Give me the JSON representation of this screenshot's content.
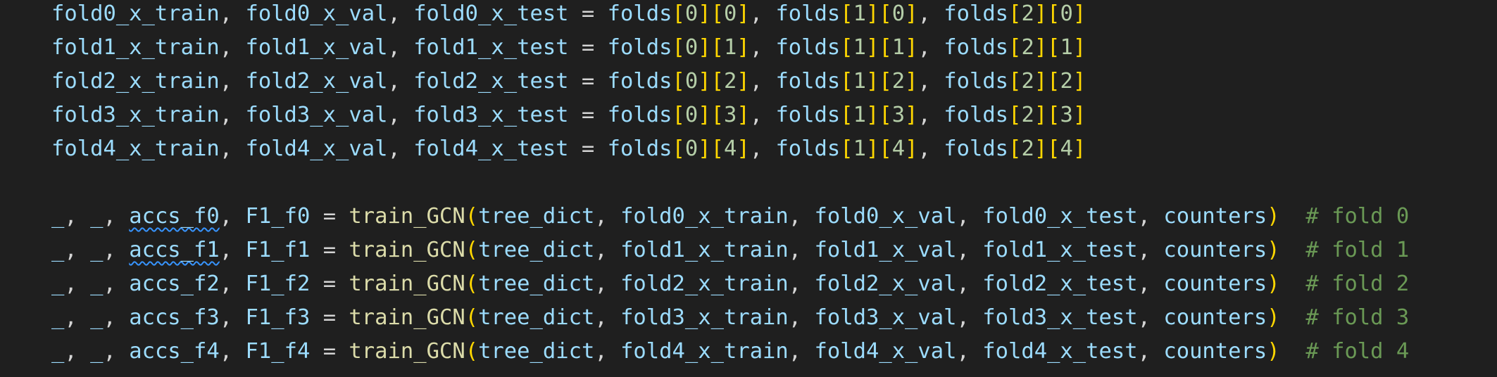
{
  "editor": {
    "lines": [
      {
        "targets": [
          "fold0_x_train",
          "fold0_x_val",
          "fold0_x_test"
        ],
        "source": "folds",
        "index": [
          "0",
          "0",
          "1",
          "0",
          "2",
          "0"
        ]
      },
      {
        "targets": [
          "fold1_x_train",
          "fold1_x_val",
          "fold1_x_test"
        ],
        "source": "folds",
        "index": [
          "0",
          "1",
          "1",
          "1",
          "2",
          "1"
        ]
      },
      {
        "targets": [
          "fold2_x_train",
          "fold2_x_val",
          "fold2_x_test"
        ],
        "source": "folds",
        "index": [
          "0",
          "2",
          "1",
          "2",
          "2",
          "2"
        ]
      },
      {
        "targets": [
          "fold3_x_train",
          "fold3_x_val",
          "fold3_x_test"
        ],
        "source": "folds",
        "index": [
          "0",
          "3",
          "1",
          "3",
          "2",
          "3"
        ]
      },
      {
        "targets": [
          "fold4_x_train",
          "fold4_x_val",
          "fold4_x_test"
        ],
        "source": "folds",
        "index": [
          "0",
          "4",
          "1",
          "4",
          "2",
          "4"
        ]
      }
    ],
    "calls": [
      {
        "acc": "accs_f0",
        "f1": "F1_f0",
        "fn": "train_GCN",
        "args": [
          "tree_dict",
          "fold0_x_train",
          "fold0_x_val",
          "fold0_x_test",
          "counters"
        ],
        "comment": "# fold 0"
      },
      {
        "acc": "accs_f1",
        "f1": "F1_f1",
        "fn": "train_GCN",
        "args": [
          "tree_dict",
          "fold1_x_train",
          "fold1_x_val",
          "fold1_x_test",
          "counters"
        ],
        "comment": "# fold 1"
      },
      {
        "acc": "accs_f2",
        "f1": "F1_f2",
        "fn": "train_GCN",
        "args": [
          "tree_dict",
          "fold2_x_train",
          "fold2_x_val",
          "fold2_x_test",
          "counters"
        ],
        "comment": "# fold 2"
      },
      {
        "acc": "accs_f3",
        "f1": "F1_f3",
        "fn": "train_GCN",
        "args": [
          "tree_dict",
          "fold3_x_train",
          "fold3_x_val",
          "fold3_x_test",
          "counters"
        ],
        "comment": "# fold 3"
      },
      {
        "acc": "accs_f4",
        "f1": "F1_f4",
        "fn": "train_GCN",
        "args": [
          "tree_dict",
          "fold4_x_train",
          "fold4_x_val",
          "fold4_x_test",
          "counters"
        ],
        "comment": "# fold 4"
      }
    ],
    "underscore": "_",
    "colors": {
      "background": "#1f1f1f",
      "variable": "#9cdcfe",
      "function": "#dcdcaa",
      "bracket": "#ffd700",
      "comment": "#6a9955",
      "squiggle": "#3794ff"
    }
  }
}
